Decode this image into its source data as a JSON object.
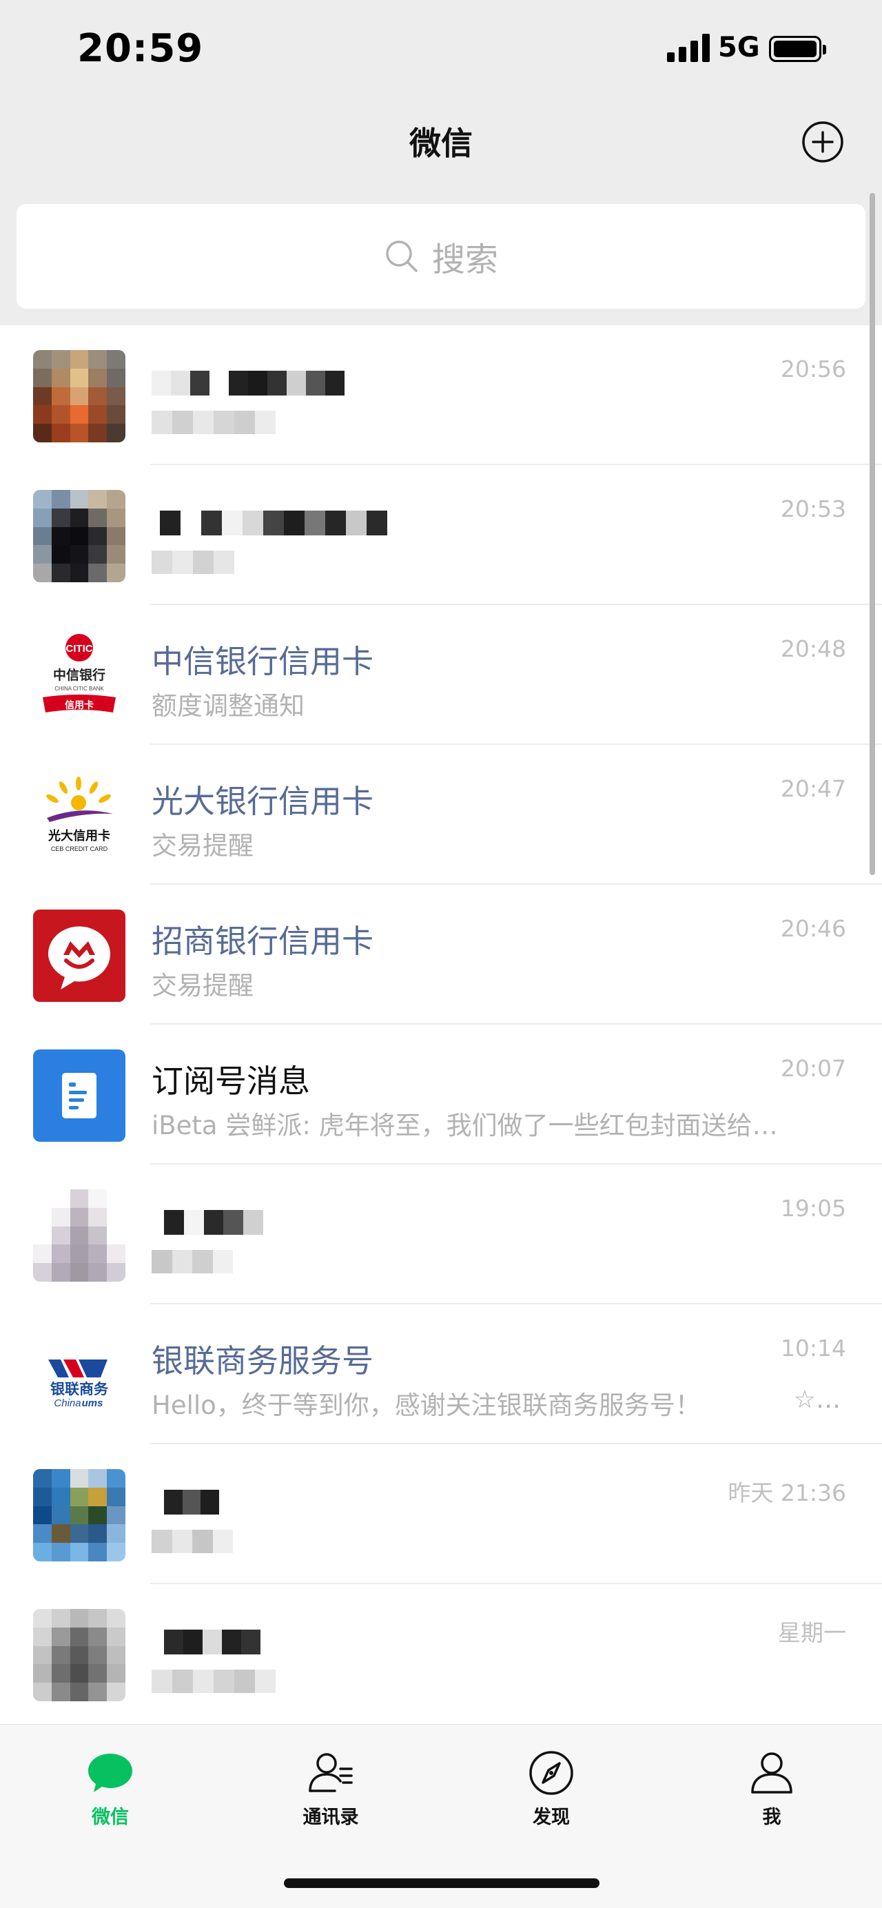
{
  "status_bar": {
    "time": "20:59",
    "network": "5G"
  },
  "nav": {
    "title": "微信",
    "add_icon": "plus-circle-icon"
  },
  "search": {
    "placeholder": "搜索",
    "icon": "search-icon"
  },
  "chats": [
    {
      "name": "",
      "preview": "",
      "time": "20:56",
      "kind": "redacted"
    },
    {
      "name": "",
      "preview": "",
      "time": "20:53",
      "kind": "redacted"
    },
    {
      "name": "中信银行信用卡",
      "preview": "额度调整通知",
      "time": "20:48",
      "kind": "official",
      "avatar": {
        "line1": "中信银行",
        "line2": "CHINA CITIC BANK",
        "badge": "信用卡",
        "logo_text": "CITIC"
      }
    },
    {
      "name": "光大银行信用卡",
      "preview": "交易提醒",
      "time": "20:47",
      "kind": "official",
      "avatar": {
        "line1": "光大信用卡",
        "line2": "CEB CREDIT CARD"
      }
    },
    {
      "name": "招商银行信用卡",
      "preview": "交易提醒",
      "time": "20:46",
      "kind": "official"
    },
    {
      "name": "订阅号消息",
      "preview": "iBeta 尝鲜派: 虎年将至，我们做了一些红包封面送给…",
      "time": "20:07",
      "kind": "subscription"
    },
    {
      "name": "",
      "preview": "",
      "time": "19:05",
      "kind": "redacted"
    },
    {
      "name": "银联商务服务号",
      "preview": "Hello，终于等到你，感谢关注银联商务服务号！",
      "time": "10:14",
      "kind": "official",
      "preview_suffix": "☆…",
      "avatar": {
        "line1": "银联商务",
        "line2": "China",
        "line2b": "ums"
      }
    },
    {
      "name": "",
      "preview": "",
      "time": "昨天 21:36",
      "kind": "redacted"
    },
    {
      "name": "",
      "preview": "",
      "time": "星期一",
      "kind": "redacted"
    }
  ],
  "tabs": [
    {
      "label": "微信",
      "icon": "chat-bubble-icon",
      "active": true
    },
    {
      "label": "通讯录",
      "icon": "contacts-icon",
      "active": false
    },
    {
      "label": "发现",
      "icon": "compass-icon",
      "active": false
    },
    {
      "label": "我",
      "icon": "person-icon",
      "active": false
    }
  ],
  "colors": {
    "accent": "#07c160",
    "official_name": "#576b95",
    "background": "#ededed",
    "citic_red": "#d6001c",
    "cmb_red": "#c8161e",
    "subscription_blue": "#2b7fe0",
    "unionpay_blue": "#1b4a9c"
  }
}
